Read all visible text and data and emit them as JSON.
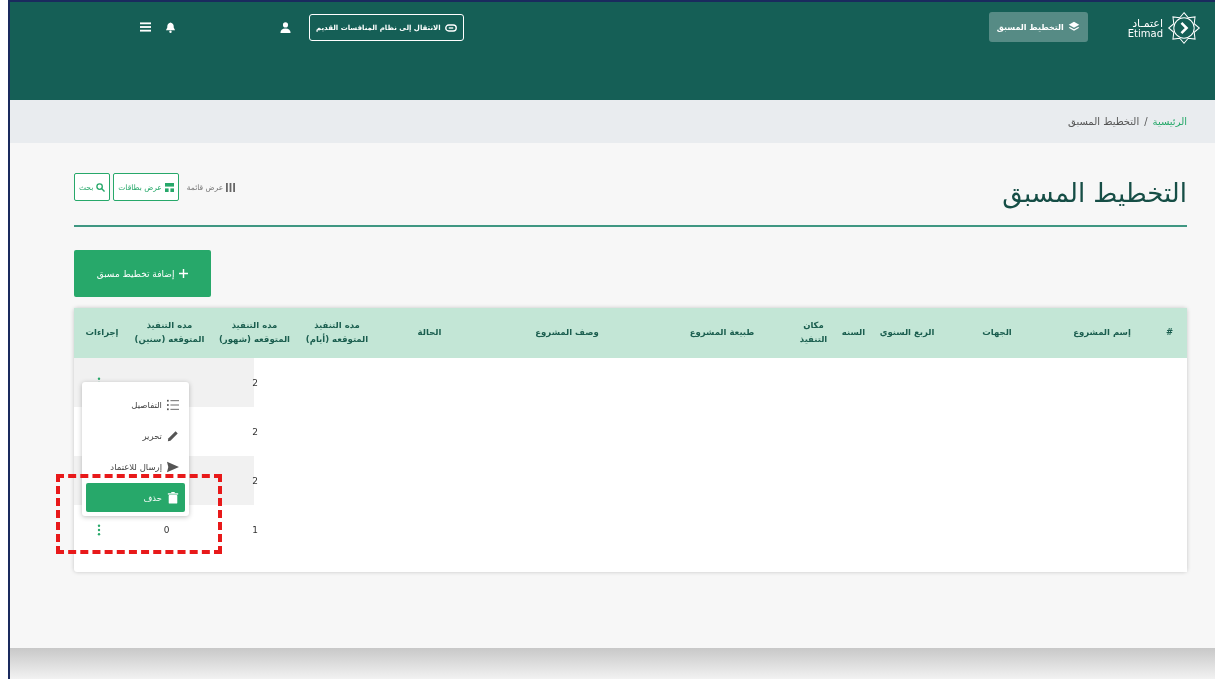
{
  "header": {
    "logo_arabic": "اعتمـاد",
    "logo_latin": "Etimad",
    "nav_button": "التخطيط المسبق",
    "old_system_button": "الانتقال إلى نظام المنافسات القديم"
  },
  "breadcrumb": [
    {
      "label": "الرئيسية",
      "link": true
    },
    {
      "label": "/",
      "link": false
    },
    {
      "label": "التخطيط المسبق",
      "link": false
    }
  ],
  "page_title": "التخطيط المسبق",
  "view_options": [
    {
      "label": "عرض قائمة",
      "selected": false
    },
    {
      "label": "عرض بطاقات",
      "selected": true
    }
  ],
  "search_button": "بحث",
  "add_button": "إضافة تخطيط مسبق",
  "table": {
    "columns": [
      "#",
      "إسم المشروع",
      "الجهات",
      "الربع السنوي",
      "السنه",
      "مكان التنفيذ",
      "طبيعة المشروع",
      "وصف المشروع",
      "الحالة",
      "مده التنفيذ المتوقعه (أيام)",
      "مده التنفيذ المتوقعه (شهور)",
      "مده التنفيذ المتوقعه (سنين)",
      "إجراءات"
    ],
    "rows": [
      {
        "months": "2"
      },
      {
        "months": "2"
      },
      {
        "months": "2"
      },
      {
        "months": "1",
        "years": "0"
      }
    ]
  },
  "action_menu": {
    "items": [
      {
        "label": "التفاصيل",
        "selected": false
      },
      {
        "label": "تحرير",
        "selected": false
      },
      {
        "label": "إرسال للاعتماد",
        "selected": false
      },
      {
        "label": "حذف",
        "selected": true
      }
    ]
  }
}
